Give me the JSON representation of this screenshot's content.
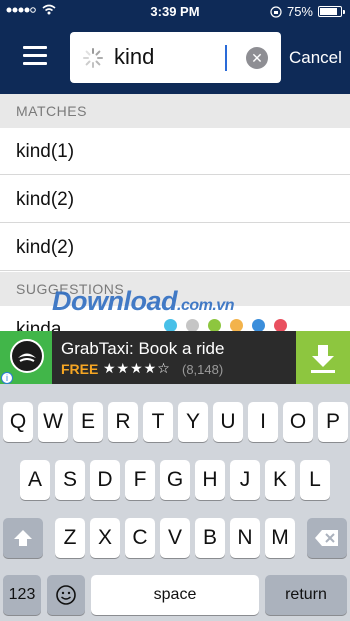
{
  "status_bar": {
    "time": "3:39 PM",
    "battery_percent": "75%",
    "battery_level": 0.75
  },
  "header": {
    "menu_icon": "hamburger-menu-icon",
    "search": {
      "value": "kind",
      "loading_icon": "spinner-icon",
      "clear_icon": "clear-circle-icon"
    },
    "cancel_label": "Cancel"
  },
  "matches": {
    "header": "MATCHES",
    "items": [
      "kind(1)",
      "kind(2)",
      "kind(2)"
    ]
  },
  "suggestions": {
    "header": "SUGGESTIONS",
    "items": [
      "kinda"
    ]
  },
  "watermark": {
    "brand": "Download",
    "suffix": ".com.vn",
    "dot_colors": [
      "#48c0e8",
      "#c5c5c5",
      "#8dc63f",
      "#f3b34b",
      "#3b8edb",
      "#e9505f"
    ]
  },
  "ad": {
    "title": "GrabTaxi: Book a ride",
    "price": "FREE",
    "stars": "★★★★☆",
    "rating_value": 4.5,
    "rating_count": "(8,148)",
    "info_icon": "info-icon",
    "download_icon": "download-arrow-icon",
    "brand_color": "#41b649"
  },
  "keyboard": {
    "row1": [
      "Q",
      "W",
      "E",
      "R",
      "T",
      "Y",
      "U",
      "I",
      "O",
      "P"
    ],
    "row2": [
      "A",
      "S",
      "D",
      "F",
      "G",
      "H",
      "J",
      "K",
      "L"
    ],
    "row3": [
      "Z",
      "X",
      "C",
      "V",
      "B",
      "N",
      "M"
    ],
    "shift_icon": "shift-arrow-icon",
    "delete_icon": "backspace-icon",
    "numbers_label": "123",
    "emoji_icon": "emoji-icon",
    "space_label": "space",
    "return_label": "return"
  }
}
